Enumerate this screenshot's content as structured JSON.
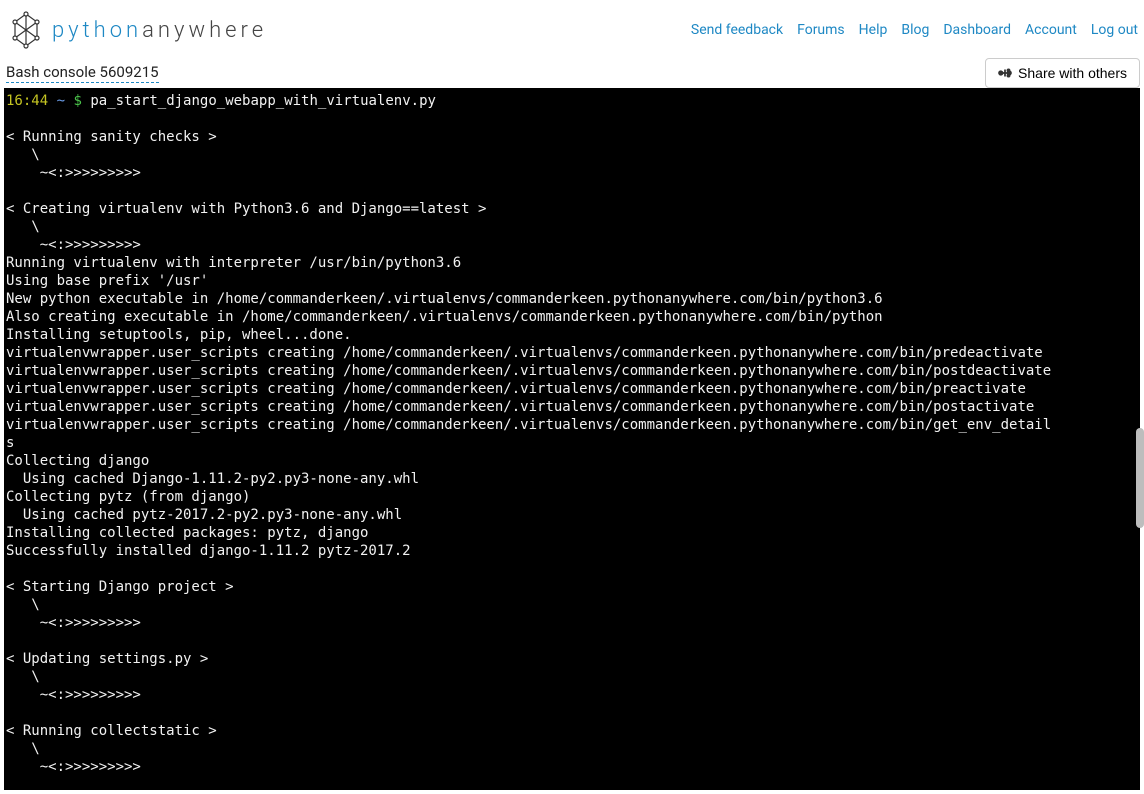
{
  "brand": {
    "accent": "python",
    "rest": "anywhere"
  },
  "nav": {
    "feedback": "Send feedback",
    "forums": "Forums",
    "help": "Help",
    "blog": "Blog",
    "dashboard": "Dashboard",
    "account": "Account",
    "logout": "Log out"
  },
  "console": {
    "title": "Bash console 5609215",
    "share": "Share with others"
  },
  "prompt": {
    "time": "16:44",
    "tilde": "~",
    "dollar": "$",
    "command": "pa_start_django_webapp_with_virtualenv.py"
  },
  "output_lines": [
    "",
    "< Running sanity checks >",
    "   \\",
    "    ~<:>>>>>>>>>",
    "",
    "< Creating virtualenv with Python3.6 and Django==latest >",
    "   \\",
    "    ~<:>>>>>>>>>",
    "Running virtualenv with interpreter /usr/bin/python3.6",
    "Using base prefix '/usr'",
    "New python executable in /home/commanderkeen/.virtualenvs/commanderkeen.pythonanywhere.com/bin/python3.6",
    "Also creating executable in /home/commanderkeen/.virtualenvs/commanderkeen.pythonanywhere.com/bin/python",
    "Installing setuptools, pip, wheel...done.",
    "virtualenvwrapper.user_scripts creating /home/commanderkeen/.virtualenvs/commanderkeen.pythonanywhere.com/bin/predeactivate",
    "virtualenvwrapper.user_scripts creating /home/commanderkeen/.virtualenvs/commanderkeen.pythonanywhere.com/bin/postdeactivate",
    "virtualenvwrapper.user_scripts creating /home/commanderkeen/.virtualenvs/commanderkeen.pythonanywhere.com/bin/preactivate",
    "virtualenvwrapper.user_scripts creating /home/commanderkeen/.virtualenvs/commanderkeen.pythonanywhere.com/bin/postactivate",
    "virtualenvwrapper.user_scripts creating /home/commanderkeen/.virtualenvs/commanderkeen.pythonanywhere.com/bin/get_env_detail",
    "s",
    "Collecting django",
    "  Using cached Django-1.11.2-py2.py3-none-any.whl",
    "Collecting pytz (from django)",
    "  Using cached pytz-2017.2-py2.py3-none-any.whl",
    "Installing collected packages: pytz, django",
    "Successfully installed django-1.11.2 pytz-2017.2",
    "",
    "< Starting Django project >",
    "   \\",
    "    ~<:>>>>>>>>>",
    "",
    "< Updating settings.py >",
    "   \\",
    "    ~<:>>>>>>>>>",
    "",
    "< Running collectstatic >",
    "   \\",
    "    ~<:>>>>>>>>>"
  ]
}
